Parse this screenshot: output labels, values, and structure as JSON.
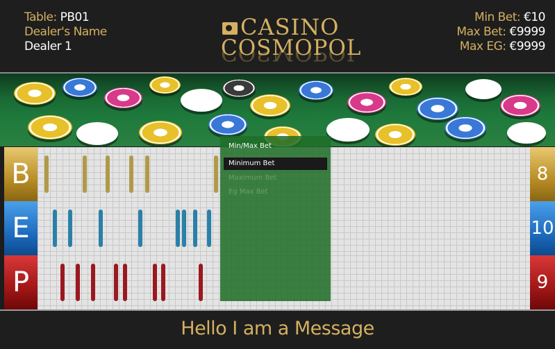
{
  "header": {
    "table_label": "Table:",
    "table_value": "PB01",
    "dealer_label": "Dealer's Name",
    "dealer_value": "Dealer 1",
    "logo_line1": "CASINO",
    "logo_line2": "COSMOPOL",
    "min_bet_label": "Min Bet:",
    "min_bet_value": "€10",
    "max_bet_label": "Max Bet:",
    "max_bet_value": "€9999",
    "max_eg_label": "Max EG:",
    "max_eg_value": "€9999"
  },
  "roads": [
    {
      "letter": "B",
      "count": "8",
      "color": "#b88d25"
    },
    {
      "letter": "E",
      "count": "10",
      "color": "#1e6cbf"
    },
    {
      "letter": "P",
      "count": "9",
      "color": "#a21717"
    }
  ],
  "dropdown": {
    "title": "Min/Max Bet",
    "items": [
      "Minimum Bet",
      "Maximum Bet",
      "Eg Max Bet"
    ],
    "selected": "Minimum Bet"
  },
  "message": "Hello I am a Message"
}
